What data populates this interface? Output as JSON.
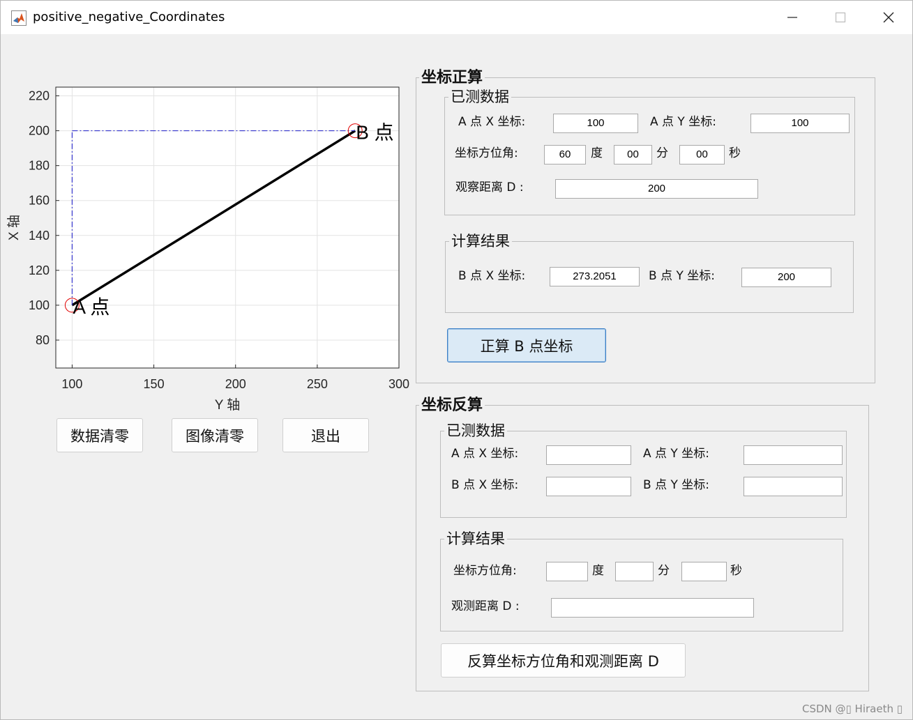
{
  "window": {
    "title": "positive_negative_Coordinates"
  },
  "plot": {
    "xlabel": "Y 轴",
    "ylabel": "X 轴",
    "point_a_label": "A 点",
    "point_b_label": "B 点",
    "xticks": [
      "100",
      "150",
      "200",
      "250",
      "300"
    ],
    "yticks": [
      "80",
      "100",
      "120",
      "140",
      "160",
      "180",
      "200",
      "220"
    ]
  },
  "chart_data": {
    "type": "line",
    "xlabel": "Y 轴",
    "ylabel": "X 轴",
    "xlim": [
      90,
      300
    ],
    "ylim": [
      64,
      225
    ],
    "grid": true,
    "series": [
      {
        "name": "A 点",
        "x": [
          100
        ],
        "y": [
          100
        ],
        "marker": "circle",
        "color": "#e00000"
      },
      {
        "name": "B 点",
        "x": [
          273.2051
        ],
        "y": [
          200
        ],
        "marker": "circle",
        "color": "#e00000"
      }
    ],
    "segments": [
      {
        "from": [
          100,
          100
        ],
        "to": [
          273.2051,
          200
        ],
        "style": "solid",
        "color": "#000000"
      },
      {
        "from": [
          100,
          100
        ],
        "to": [
          100,
          200
        ],
        "style": "dash-dot",
        "color": "#3333cc"
      },
      {
        "from": [
          100,
          200
        ],
        "to": [
          273.2051,
          200
        ],
        "style": "dash-dot",
        "color": "#3333cc"
      }
    ],
    "annotations": [
      "A 点",
      "B 点"
    ]
  },
  "left_buttons": {
    "clear_data": "数据清零",
    "clear_image": "图像清零",
    "exit": "退出"
  },
  "forward": {
    "title": "坐标正算",
    "measured_title": "已测数据",
    "a_x_label": "A 点 X 坐标:",
    "a_x_value": "100",
    "a_y_label": "A 点 Y 坐标:",
    "a_y_value": "100",
    "azimuth_label": "坐标方位角:",
    "deg_value": "60",
    "deg_unit": "度",
    "min_value": "00",
    "min_unit": "分",
    "sec_value": "00",
    "sec_unit": "秒",
    "distance_label": "观察距离 D :",
    "distance_value": "200",
    "result_title": "计算结果",
    "b_x_label": "B 点 X 坐标:",
    "b_x_value": "273.2051",
    "b_y_label": "B 点 Y 坐标:",
    "b_y_value": "200",
    "button": "正算 B 点坐标"
  },
  "inverse": {
    "title": "坐标反算",
    "measured_title": "已测数据",
    "a_x_label": "A 点 X 坐标:",
    "a_y_label": "A 点 Y 坐标:",
    "b_x_label": "B 点 X 坐标:",
    "b_y_label": "B 点 Y 坐标:",
    "result_title": "计算结果",
    "azimuth_label": "坐标方位角:",
    "deg_unit": "度",
    "min_unit": "分",
    "sec_unit": "秒",
    "distance_label": "观测距离 D :",
    "button": "反算坐标方位角和观测距离 D"
  },
  "watermark": "CSDN @▯ Hiraeth ▯"
}
